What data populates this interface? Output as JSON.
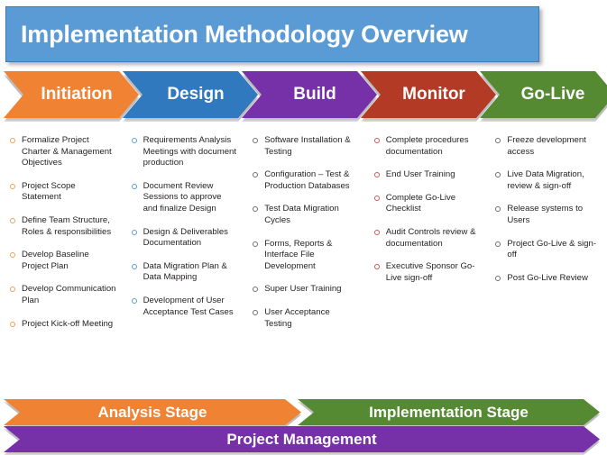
{
  "header": {
    "title": "Implementation Methodology Overview",
    "background_color": "#5B9BD5",
    "text_color": "#FFFFFF"
  },
  "phases": [
    {
      "label": "Initiation",
      "color": "#F08234",
      "bullet_color": "#F0A05A"
    },
    {
      "label": "Design",
      "color": "#3079BE",
      "bullet_color": "#5B9BD5"
    },
    {
      "label": "Build",
      "color": "#7630A8",
      "bullet_color": "#6E6E6E"
    },
    {
      "label": "Monitor",
      "color": "#B33A25",
      "bullet_color": "#D4564A"
    },
    {
      "label": "Go-Live",
      "color": "#558A32",
      "bullet_color": "#6E6E6E"
    }
  ],
  "columns": [
    {
      "phase": "Initiation",
      "items": [
        "Formalize Project Charter & Management Objectives",
        "Project Scope Statement",
        "Define Team Structure, Roles & responsibilities",
        "Develop Baseline Project Plan",
        "Develop Communication Plan",
        "Project Kick-off Meeting"
      ]
    },
    {
      "phase": "Design",
      "items": [
        "Requirements Analysis Meetings with document production",
        "Document Review Sessions to approve and finalize Design",
        "Design & Deliverables Documentation",
        "Data Migration Plan & Data Mapping",
        "Development of User Acceptance Test Cases"
      ]
    },
    {
      "phase": "Build",
      "items": [
        "Software Installation & Testing",
        "Configuration – Test & Production Databases",
        "Test Data Migration Cycles",
        "Forms, Reports & Interface File Development",
        "Super User Training",
        "User Acceptance Testing"
      ]
    },
    {
      "phase": "Monitor",
      "items": [
        "Complete procedures documentation",
        "End User Training",
        "Complete Go-Live Checklist",
        "Audit Controls review & documentation",
        "Executive Sponsor Go-Live sign-off"
      ]
    },
    {
      "phase": "Go-Live",
      "items": [
        "Freeze development access",
        "Live Data Migration, review & sign-off",
        "Release systems to Users",
        "Project Go-Live & sign-off",
        "Post Go-Live Review"
      ]
    }
  ],
  "stages": [
    {
      "label": "Analysis Stage",
      "color": "#F08234"
    },
    {
      "label": "Implementation Stage",
      "color": "#558A32"
    }
  ],
  "project_management": {
    "label": "Project Management",
    "color": "#7630A8"
  }
}
